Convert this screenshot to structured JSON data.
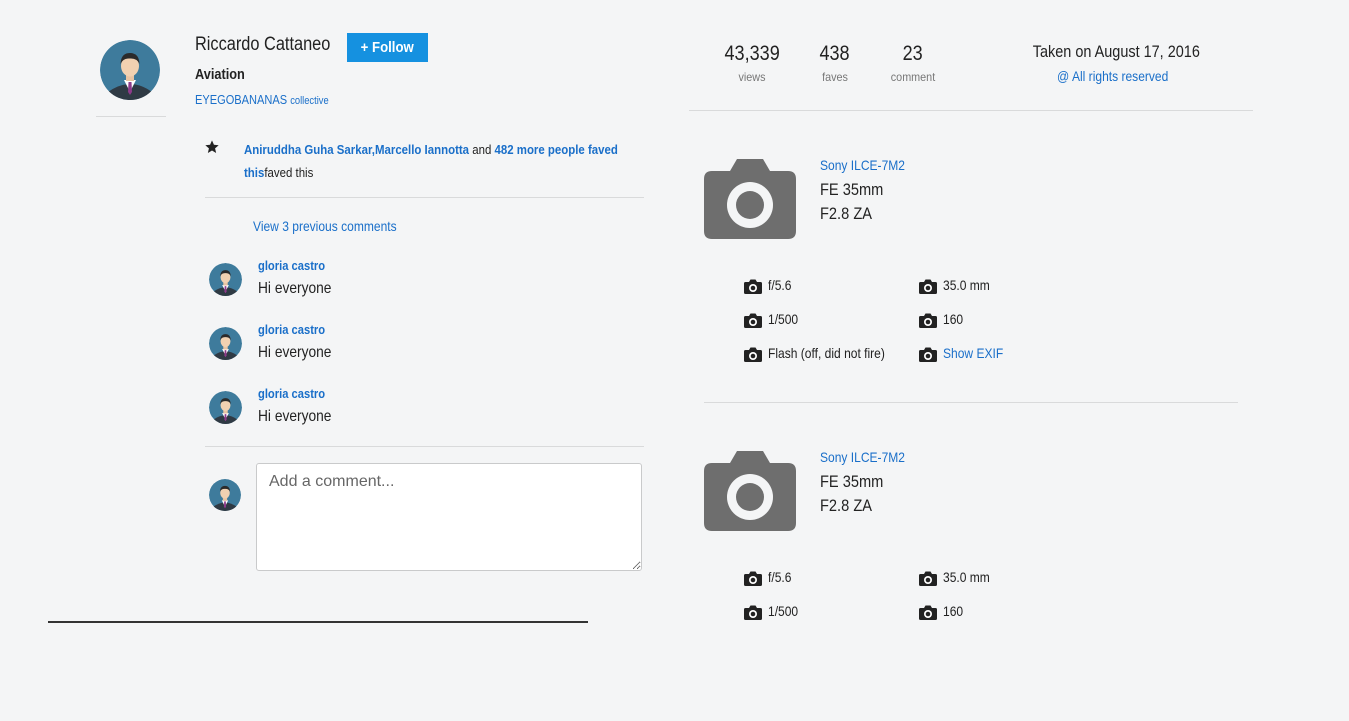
{
  "author": {
    "name": "Riccardo Cattaneo",
    "follow_label": "+ Follow",
    "group": "Aviation",
    "collective_name": "EYEGOBANANAS",
    "collective_suffix": "collective"
  },
  "faves": {
    "person1": "Aniruddha Guha Sarkar",
    "separator": ",",
    "person2": "Marcello Iannotta",
    "and": " and ",
    "more": "482 more people faved this",
    "tail": "faved this"
  },
  "comments": {
    "view_previous": "View 3 previous comments",
    "items": [
      {
        "name": "gloria castro",
        "text": "Hi everyone"
      },
      {
        "name": "gloria castro",
        "text": "Hi everyone"
      },
      {
        "name": "gloria castro",
        "text": "Hi everyone"
      }
    ],
    "input_placeholder": "Add a comment..."
  },
  "stats": {
    "views": {
      "value": "43,339",
      "label": "views"
    },
    "faves": {
      "value": "438",
      "label": "faves"
    },
    "comments": {
      "value": "23",
      "label": "comment"
    }
  },
  "meta": {
    "taken_on": "Taken on August 17, 2016",
    "rights": "@ All rights reserved"
  },
  "cameras": [
    {
      "make": "Sony ILCE-7M2",
      "lens": "FE 35mm F2.8 ZA",
      "exif": [
        "f/5.6",
        "35.0 mm",
        "1/500",
        "160",
        "Flash (off, did not fire)",
        "Show EXIF"
      ]
    },
    {
      "make": "Sony ILCE-7M2",
      "lens": "FE 35mm F2.8 ZA",
      "exif": [
        "f/5.6",
        "35.0 mm",
        "1/500",
        "160"
      ]
    }
  ],
  "icons": {
    "star": "star-icon",
    "camera": "camera-icon",
    "avatar": "user-avatar"
  },
  "colors": {
    "accent": "#1591e0",
    "link": "#1a6fc9",
    "camera_gray": "#6e6e6e"
  }
}
